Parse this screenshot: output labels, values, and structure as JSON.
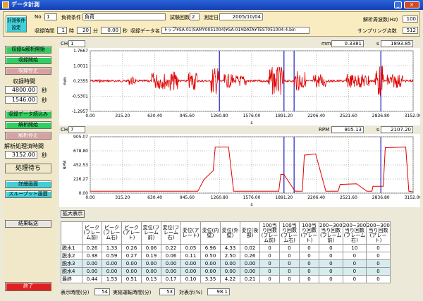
{
  "window": {
    "title": "データ計測"
  },
  "header": {
    "settings_button": "計測条件設定",
    "no_label": "No",
    "no_value": "1",
    "load_cond_label": "負荷条件",
    "load_cond_value": "負荷",
    "test_count_label": "試験回数",
    "test_count_value": "2",
    "date_label": "測定日",
    "date_value": "2005/10/04",
    "analysis_freq_label": "解析周波数(Hz)",
    "analysis_freq_value": "100",
    "time_label": "収録時間",
    "time_h": "1",
    "time_h_unit": "時",
    "time_m": "20",
    "time_m_unit": "分",
    "time_s": "0.00",
    "time_s_unit": "秒",
    "data_name_label": "収録データ名",
    "data_name_value": "トップ¥SA-01(SAMY0051004)¥SA-01¥DATA¥TEST051004-4.bin",
    "sampling_label": "サンプリング点数",
    "sampling_value": "512"
  },
  "left_panel": {
    "btn_rec_analysis_start": "収録&解析開始",
    "btn_rec_start": "収録開始",
    "btn_rec_stop": "収録停止",
    "rec_time_label": "収録時間",
    "rec_time_total": "4800.00",
    "rec_time_elapsed": "1546.00",
    "sec_unit": "秒",
    "btn_load_data": "収録データ読込み",
    "btn_analysis_start": "解析開始",
    "btn_analysis_stop": "解析停止",
    "analysis_time_label": "解析処理済時間",
    "analysis_time_value": "3152.00",
    "status": "処理待ち",
    "btn_detail": "詳細画面",
    "btn_throughput": "スループット画面",
    "btn_result_transfer": "結果転送",
    "btn_exit": "終了"
  },
  "chart1": {
    "ch_label": "CH",
    "ch_value": "1",
    "unit_label": "mm",
    "readout_y": "0.3381",
    "readout_s_label": "s",
    "readout_x": "1893.85",
    "ylabel": "mm",
    "xlabel": "s"
  },
  "chart2": {
    "ch_label": "CH",
    "ch_value": "7",
    "unit_label": "RPM",
    "readout_y": "805.13",
    "readout_s_label": "s",
    "readout_x": "2107.20",
    "ylabel": "RPM",
    "xlabel": "s"
  },
  "expand_button": "拡大表示",
  "table": {
    "headers": [
      "ピーク(フレーム前)",
      "ピーク(フレーム右)",
      "ピーク(アレート)",
      "変位(フレーム前)",
      "変位(フレーム右)",
      "変位(アレート)",
      "変位(内壁)",
      "変位(外壁)",
      "変位(後部)",
      "100当り回数(フレーム前)",
      "100当り回数(フレーム右)",
      "100当り回数(アレート)",
      "200~300当り回数(フレーム前)",
      "200~300当り回数(フレーム右)",
      "200~300当り回数(アレート)"
    ],
    "rows": [
      {
        "label": "脱水1",
        "values": [
          "0.26",
          "1.33",
          "0.26",
          "0.06",
          "0.22",
          "0.05",
          "6.96",
          "4.33",
          "0.02",
          "0",
          "0",
          "0",
          "0",
          "10",
          "0"
        ]
      },
      {
        "label": "脱水2",
        "values": [
          "0.38",
          "0.59",
          "0.27",
          "0.19",
          "0.06",
          "0.11",
          "0.50",
          "2.50",
          "0.26",
          "0",
          "0",
          "0",
          "0",
          "0",
          "0"
        ]
      },
      {
        "label": "脱水3",
        "values": [
          "0.00",
          "0.00",
          "0.00",
          "0.00",
          "0.00",
          "0.00",
          "0.00",
          "0.00",
          "0.00",
          "0",
          "0",
          "0",
          "0",
          "0",
          "0"
        ]
      },
      {
        "label": "脱水4",
        "values": [
          "0.00",
          "0.00",
          "0.00",
          "0.00",
          "0.00",
          "0.00",
          "0.00",
          "0.00",
          "0.00",
          "0",
          "0",
          "0",
          "0",
          "0",
          "0"
        ]
      },
      {
        "label": "最終",
        "values": [
          "0.44",
          "1.53",
          "0.51",
          "0.13",
          "0.17",
          "0.10",
          "3.35",
          "4.22",
          "0.21",
          "0",
          "0",
          "0",
          "0",
          "0",
          "0"
        ]
      }
    ]
  },
  "footer": {
    "display_time_label": "表示時間(分)",
    "display_time_value": "54",
    "actual_time_label": "実総運転時間(分)",
    "actual_time_value": "53",
    "ratio_label": "対表示(%)",
    "ratio_value": "98.1"
  },
  "chart_data": [
    {
      "type": "line",
      "title": "",
      "xlabel": "s",
      "ylabel": "mm",
      "xlim": [
        0.0,
        3152.0
      ],
      "ylim": [
        -1.2957,
        1.7667
      ],
      "x_ticks": [
        "0.00",
        "315.20",
        "630.40",
        "945.60",
        "1260.80",
        "1576.00",
        "1891.20",
        "2206.40",
        "2521.60",
        "2836.80",
        "3152.00"
      ],
      "y_ticks": [
        "1.7667",
        "1.0011",
        "0.2355",
        "-0.5301",
        "-1.2957"
      ],
      "cursor_lines_x": [
        1260.8,
        1891.2,
        1990.0,
        2836.8
      ],
      "series": [
        {
          "x": [
            0,
            300,
            600,
            900,
            1100,
            1260,
            1500,
            1700,
            1890,
            2200,
            2500,
            2800,
            3152
          ],
          "y": [
            0.24,
            0.24,
            0.24,
            0.24,
            0.24,
            0.24,
            0.24,
            0.24,
            0.24,
            0.24,
            0.24,
            0.24,
            0.24
          ]
        }
      ]
    },
    {
      "type": "line",
      "title": "",
      "xlabel": "s",
      "ylabel": "RPM",
      "xlim": [
        0.0,
        3152.0
      ],
      "ylim": [
        0.0,
        905.07
      ],
      "x_ticks": [
        "0.00",
        "315.20",
        "630.40",
        "945.60",
        "1260.80",
        "1576.00",
        "1891.20",
        "2206.40",
        "2521.60",
        "2836.80",
        "3152.00"
      ],
      "y_ticks": [
        "905.07",
        "678.80",
        "452.53",
        "226.27",
        "0.00"
      ],
      "cursor_lines_x": [
        1891.2,
        1990.0,
        2836.8
      ],
      "series": [
        {
          "x": [
            0,
            1050,
            1110,
            1200,
            1220,
            1350,
            1400,
            1840,
            1860,
            1890,
            2000,
            2070,
            2090,
            2200,
            2300,
            2420,
            2440,
            2600,
            2700,
            2750,
            2760,
            2860,
            2880,
            3080,
            3110,
            3152
          ],
          "y": [
            30,
            30,
            220,
            360,
            740,
            740,
            30,
            30,
            300,
            300,
            30,
            30,
            610,
            630,
            30,
            30,
            140,
            150,
            30,
            30,
            110,
            110,
            730,
            740,
            30,
            20
          ]
        }
      ]
    }
  ]
}
